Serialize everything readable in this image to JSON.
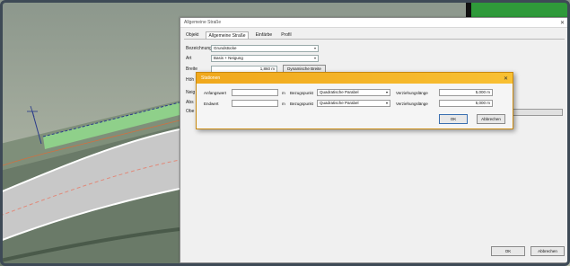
{
  "main_dialog": {
    "title": "Allgemeine Straße",
    "tabs": [
      "Objekt",
      "Allgemeine Straße",
      "Einfärbe",
      "Profil"
    ],
    "rows": [
      {
        "label": "Bezeichnung",
        "value": "Grundstücke"
      },
      {
        "label": "Art",
        "value": "Basis + Neigung"
      },
      {
        "label": "Breite",
        "value": "1,860 m",
        "button": "Dynamische Breite"
      },
      {
        "label": "Höh",
        "value": ""
      },
      {
        "label": "Neig",
        "value": ""
      },
      {
        "label": "Abs",
        "value": ""
      },
      {
        "label": "Obe",
        "value": ""
      }
    ],
    "ok_label": "OK",
    "cancel_label": "Abbrechen"
  },
  "sub_dialog": {
    "title": "Stationen",
    "rows": [
      {
        "label": "Anfangswert",
        "unit": "m",
        "ref_label": "Bezugspunkt",
        "ref_value": "Quadratische Parabel",
        "len_label": "Verziehungslänge",
        "len_value": "5,000 m"
      },
      {
        "label": "Endwert",
        "unit": "m",
        "ref_label": "Bezugspunkt",
        "ref_value": "Quadratische Parabel",
        "len_label": "Verziehungslänge",
        "len_value": "5,000 m"
      }
    ],
    "ok_label": "OK",
    "cancel_label": "Abbrechen"
  },
  "colors": {
    "accent_orange": "#f0a81c",
    "tile_green": "#2f9a3a",
    "road_gray": "#c4c4c4",
    "strip_green": "#8fd08a"
  },
  "icons": [
    "close-icon",
    "dropdown-arrow-icon",
    "axis-gizmo-icon"
  ]
}
